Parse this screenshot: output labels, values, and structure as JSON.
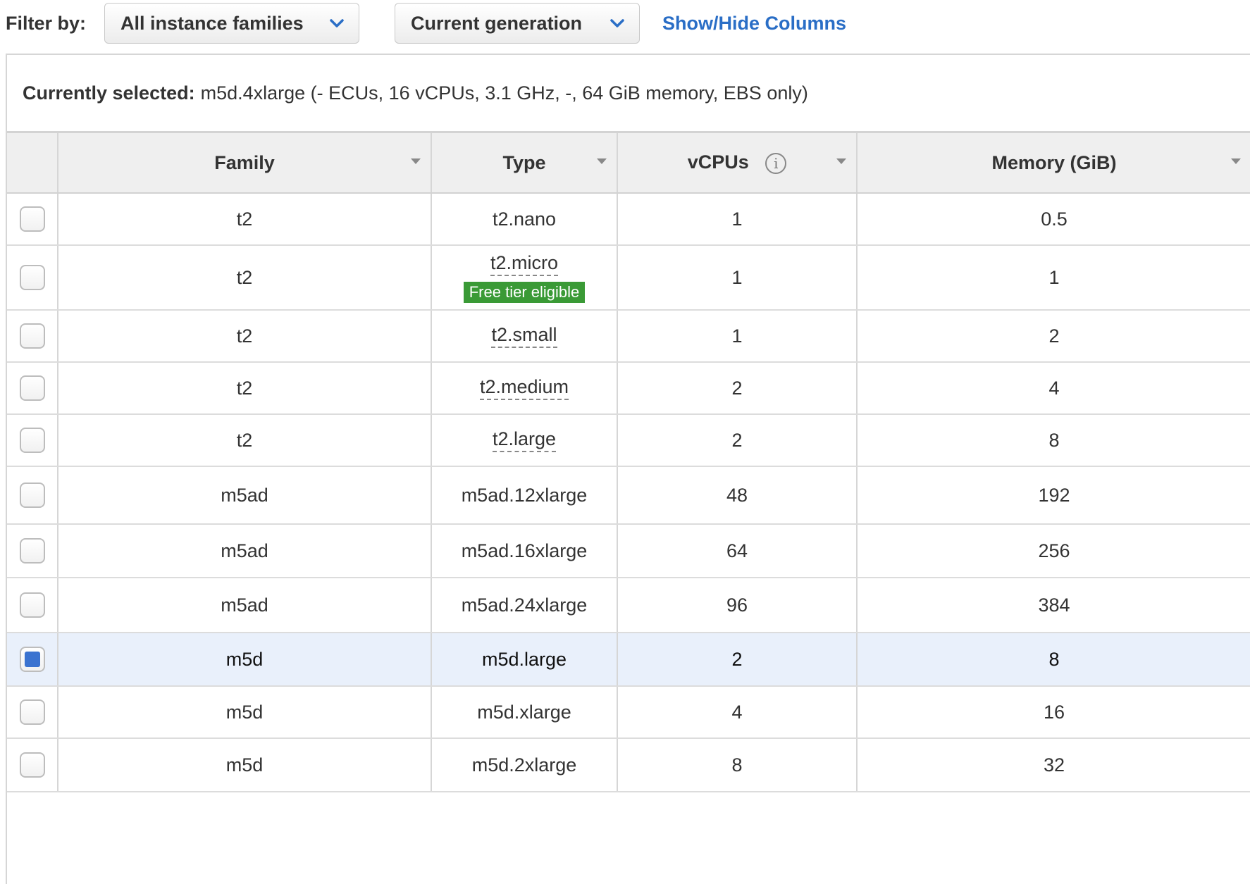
{
  "filter": {
    "label": "Filter by:",
    "family_dropdown": "All instance families",
    "generation_dropdown": "Current generation",
    "columns_link": "Show/Hide Columns"
  },
  "selection": {
    "label": "Currently selected:",
    "value": "m5d.4xlarge (- ECUs, 16 vCPUs, 3.1 GHz, -, 64 GiB memory, EBS only)"
  },
  "table": {
    "columns": [
      "Family",
      "Type",
      "vCPUs",
      "Memory (GiB)"
    ],
    "rows": [
      {
        "family": "t2",
        "type": "t2.nano",
        "vcpus": "1",
        "memory": "0.5",
        "checked": false
      },
      {
        "family": "t2",
        "type": "t2.micro",
        "badge": "Free tier eligible",
        "vcpus": "1",
        "memory": "1",
        "checked": false
      },
      {
        "family": "t2",
        "type": "t2.small",
        "vcpus": "1",
        "memory": "2",
        "checked": false
      },
      {
        "family": "t2",
        "type": "t2.medium",
        "vcpus": "2",
        "memory": "4",
        "checked": false
      },
      {
        "family": "t2",
        "type": "t2.large",
        "vcpus": "2",
        "memory": "8",
        "checked": false
      },
      {
        "family": "m5ad",
        "type": "m5ad.12xlarge",
        "vcpus": "48",
        "memory": "192",
        "checked": false
      },
      {
        "family": "m5ad",
        "type": "m5ad.16xlarge",
        "vcpus": "64",
        "memory": "256",
        "checked": false
      },
      {
        "family": "m5ad",
        "type": "m5ad.24xlarge",
        "vcpus": "96",
        "memory": "384",
        "checked": false
      },
      {
        "family": "m5d",
        "type": "m5d.large",
        "vcpus": "2",
        "memory": "8",
        "checked": true
      },
      {
        "family": "m5d",
        "type": "m5d.xlarge",
        "vcpus": "4",
        "memory": "16",
        "checked": false
      },
      {
        "family": "m5d",
        "type": "m5d.2xlarge",
        "vcpus": "8",
        "memory": "32",
        "checked": false
      }
    ]
  },
  "icons": {
    "dropdown_chevron": "chevron-down-icon",
    "sort": "sort-arrow-icon",
    "info": "info-icon"
  },
  "colors": {
    "link": "#2a6ec6",
    "badge": "#3a9a36",
    "checked": "#3b73d0",
    "selected_row": "#e9f0fb"
  }
}
